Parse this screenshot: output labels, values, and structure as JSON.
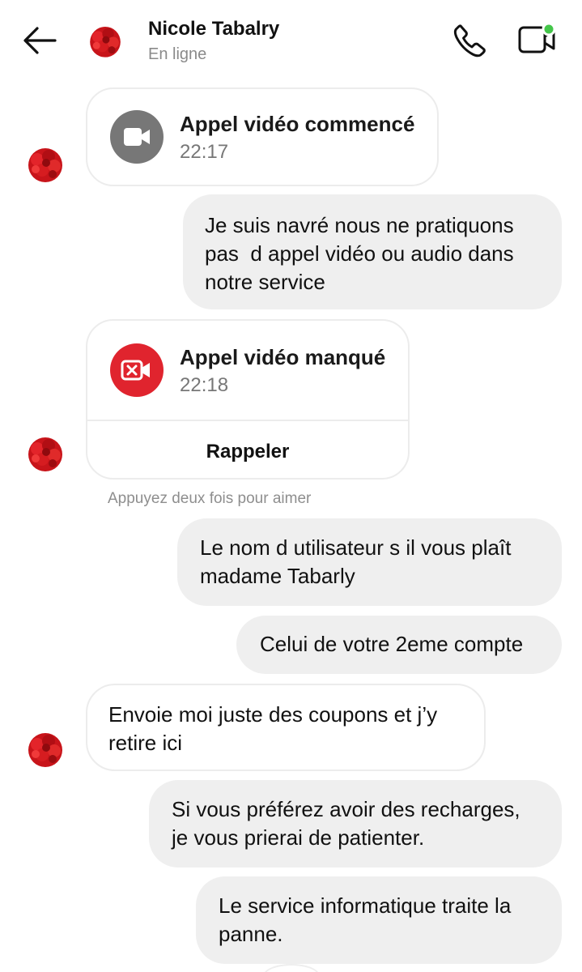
{
  "header": {
    "contact_name": "Nicole Tabalry",
    "status": "En ligne",
    "online_dot_color": "#44c64a",
    "icons": [
      "arrow-left-icon",
      "phone-icon",
      "video-camera-icon"
    ]
  },
  "messages": [
    {
      "type": "call",
      "title": "Appel vidéo commencé",
      "time": "22:17",
      "icon": "video-camera-icon",
      "icon_color": "#777777"
    },
    {
      "type": "outgoing",
      "lines": [
        "Je suis navré nous ne pratiquons",
        "pas  d appel vidéo ou audio dans",
        "notre service"
      ]
    },
    {
      "type": "call",
      "title": "Appel vidéo manqué",
      "time": "22:18",
      "icon": "missed-video-icon",
      "icon_color": "#e0242e",
      "action": "Rappeler"
    },
    {
      "type": "hint",
      "text": "Appuyez deux fois pour aimer"
    },
    {
      "type": "outgoing",
      "lines": [
        "Le nom d utilisateur s il vous plaît",
        "madame Tabarly"
      ]
    },
    {
      "type": "outgoing",
      "lines": [
        "Celui de votre 2eme compte"
      ]
    },
    {
      "type": "incoming",
      "lines": [
        "Envoie moi juste des coupons et j’y",
        "retire ici"
      ]
    },
    {
      "type": "outgoing",
      "lines": [
        "Si vous préférez avoir des recharges,",
        "je vous prierai de patienter."
      ]
    },
    {
      "type": "outgoing",
      "lines": [
        "Le service informatique traite la",
        "panne."
      ]
    }
  ],
  "colors": {
    "outgoing_bubble": "#efefef",
    "incoming_border": "#ececec",
    "avatar_red": "#d51a1a"
  }
}
